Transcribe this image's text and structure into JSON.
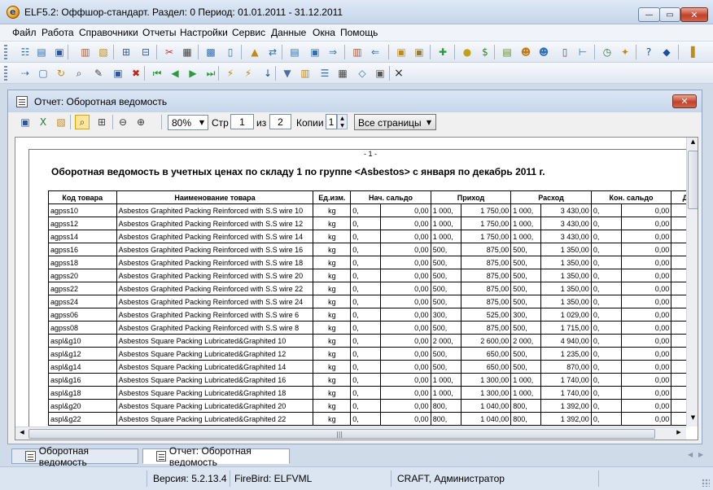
{
  "window": {
    "title": "ELF5.2: Оффшор-стандарт. Раздел: 0 Период: 01.01.2011 - 31.12.2011",
    "icon_letter": "e",
    "min_glyph": "—",
    "max_glyph": "▭",
    "close_glyph": "✕"
  },
  "menu": [
    "Файл",
    "Работа",
    "Справочники",
    "Отчеты",
    "Настройки",
    "Сервис",
    "Данные",
    "Окна",
    "Помощь"
  ],
  "toolbar2": {
    "close_glyph": "×"
  },
  "child_window": {
    "title": "Отчет: Оборотная ведомость",
    "close_glyph": "✕"
  },
  "report_toolbar": {
    "zoom": "80%",
    "page_label": "Стр",
    "page_current": "1",
    "of_label": "из",
    "page_total": "2",
    "copies_label": "Копии",
    "copies": "1",
    "pages_option": "Все страницы"
  },
  "report": {
    "page_marker": "- 1 -",
    "title": "Оборотная ведомость в учетных ценах по складу 1  по группе <Asbestos>  с января по декабрь 2011 г.",
    "columns": [
      "Код товара",
      "Наименование товара",
      "Ед.изм.",
      "Нач. сальдо",
      "Приход",
      "Расход",
      "Кон. сальдо",
      "До"
    ],
    "rows": [
      [
        "agpss10",
        "Asbestos Graphited Packing Reinforced with S.S wire 10",
        "kg",
        "0,",
        "0,00",
        "1 000,",
        "1 750,00",
        "1 000,",
        "3 430,00",
        "0,",
        "0,00"
      ],
      [
        "agpss12",
        "Asbestos Graphited Packing Reinforced with S.S wire 12",
        "kg",
        "0,",
        "0,00",
        "1 000,",
        "1 750,00",
        "1 000,",
        "3 430,00",
        "0,",
        "0,00"
      ],
      [
        "agpss14",
        "Asbestos Graphited Packing Reinforced with S.S wire 14",
        "kg",
        "0,",
        "0,00",
        "1 000,",
        "1 750,00",
        "1 000,",
        "3 430,00",
        "0,",
        "0,00"
      ],
      [
        "agpss16",
        "Asbestos Graphited Packing Reinforced with S.S wire 16",
        "kg",
        "0,",
        "0,00",
        "500,",
        "875,00",
        "500,",
        "1 350,00",
        "0,",
        "0,00"
      ],
      [
        "agpss18",
        "Asbestos Graphited Packing Reinforced with S.S wire 18",
        "kg",
        "0,",
        "0,00",
        "500,",
        "875,00",
        "500,",
        "1 350,00",
        "0,",
        "0,00"
      ],
      [
        "agpss20",
        "Asbestos Graphited Packing Reinforced with S.S wire 20",
        "kg",
        "0,",
        "0,00",
        "500,",
        "875,00",
        "500,",
        "1 350,00",
        "0,",
        "0,00"
      ],
      [
        "agpss22",
        "Asbestos Graphited Packing Reinforced with S.S wire 22",
        "kg",
        "0,",
        "0,00",
        "500,",
        "875,00",
        "500,",
        "1 350,00",
        "0,",
        "0,00"
      ],
      [
        "agpss24",
        "Asbestos Graphited Packing Reinforced with S.S wire 24",
        "kg",
        "0,",
        "0,00",
        "500,",
        "875,00",
        "500,",
        "1 350,00",
        "0,",
        "0,00"
      ],
      [
        "agpss06",
        "Asbestos Graphited Packing Reinforced with S.S wire 6",
        "kg",
        "0,",
        "0,00",
        "300,",
        "525,00",
        "300,",
        "1 029,00",
        "0,",
        "0,00"
      ],
      [
        "agpss08",
        "Asbestos Graphited Packing Reinforced with S.S wire 8",
        "kg",
        "0,",
        "0,00",
        "500,",
        "875,00",
        "500,",
        "1 715,00",
        "0,",
        "0,00"
      ],
      [
        "aspl&g10",
        "Asbestos Square Packing Lubricated&Graphited 10",
        "kg",
        "0,",
        "0,00",
        "2 000,",
        "2 600,00",
        "2 000,",
        "4 940,00",
        "0,",
        "0,00"
      ],
      [
        "aspl&g12",
        "Asbestos Square Packing Lubricated&Graphited 12",
        "kg",
        "0,",
        "0,00",
        "500,",
        "650,00",
        "500,",
        "1 235,00",
        "0,",
        "0,00"
      ],
      [
        "aspl&g14",
        "Asbestos Square Packing Lubricated&Graphited 14",
        "kg",
        "0,",
        "0,00",
        "500,",
        "650,00",
        "500,",
        "870,00",
        "0,",
        "0,00"
      ],
      [
        "aspl&g16",
        "Asbestos Square Packing Lubricated&Graphited 16",
        "kg",
        "0,",
        "0,00",
        "1 000,",
        "1 300,00",
        "1 000,",
        "1 740,00",
        "0,",
        "0,00"
      ],
      [
        "aspl&g18",
        "Asbestos Square Packing Lubricated&Graphited 18",
        "kg",
        "0,",
        "0,00",
        "1 000,",
        "1 300,00",
        "1 000,",
        "1 740,00",
        "0,",
        "0,00"
      ],
      [
        "aspl&g20",
        "Asbestos Square Packing Lubricated&Graphited 20",
        "kg",
        "0,",
        "0,00",
        "800,",
        "1 040,00",
        "800,",
        "1 392,00",
        "0,",
        "0,00"
      ],
      [
        "aspl&g22",
        "Asbestos Square Packing Lubricated&Graphited 22",
        "kg",
        "0,",
        "0,00",
        "800,",
        "1 040,00",
        "800,",
        "1 392,00",
        "0,",
        "0,00"
      ]
    ]
  },
  "tabs": [
    "Оборотная ведомость",
    "Отчет: Оборотная ведомость"
  ],
  "status": {
    "version": "Версия: 5.2.13.4",
    "db": "FireBird: ELFVML",
    "user": "CRAFT, Администратор"
  },
  "icons": {
    "toolbar1": [
      {
        "name": "tree-view-icon",
        "glyph": "☷",
        "color": "#2f6fb5"
      },
      {
        "name": "grid-view-icon",
        "glyph": "▤",
        "color": "#2f6fb5"
      },
      {
        "name": "box-icon",
        "glyph": "▣",
        "color": "#2c56a0"
      },
      {
        "name": "books-icon",
        "glyph": "▥",
        "color": "#b5542c"
      },
      {
        "name": "folder-add-icon",
        "glyph": "▧",
        "color": "#c28a18"
      },
      {
        "name": "hierarchy-icon",
        "glyph": "⊞",
        "color": "#3a5f9a"
      },
      {
        "name": "structure-icon",
        "glyph": "⊟",
        "color": "#3a5f9a"
      },
      {
        "name": "tools-icon",
        "glyph": "✂",
        "color": "#c23a2a"
      },
      {
        "name": "printer-icon",
        "glyph": "▦",
        "color": "#444444"
      },
      {
        "name": "calculator-icon",
        "glyph": "▩",
        "color": "#2f6fb5"
      },
      {
        "name": "document-icon",
        "glyph": "▯",
        "color": "#2f6fb5"
      },
      {
        "name": "lock-icon",
        "glyph": "▲",
        "color": "#c28a18"
      },
      {
        "name": "transfer-icon",
        "glyph": "⇄",
        "color": "#2f6fb5"
      },
      {
        "name": "calendar-icon",
        "glyph": "▤",
        "color": "#2f6fb5"
      },
      {
        "name": "image-icon",
        "glyph": "▣",
        "color": "#2f6fb5"
      },
      {
        "name": "export-icon",
        "glyph": "⇒",
        "color": "#2f6fb5"
      },
      {
        "name": "journal-icon",
        "glyph": "▥",
        "color": "#b5542c"
      },
      {
        "name": "import-icon",
        "glyph": "⇐",
        "color": "#2f6fb5"
      },
      {
        "name": "package-icon",
        "glyph": "▣",
        "color": "#c28a18"
      },
      {
        "name": "package2-icon",
        "glyph": "▣",
        "color": "#9a7a3a"
      },
      {
        "name": "add-green-icon",
        "glyph": "✚",
        "color": "#2a9a3a"
      },
      {
        "name": "coin-icon",
        "glyph": "●",
        "color": "#c2a018"
      },
      {
        "name": "dollar-icon",
        "glyph": "$",
        "color": "#2a8a2a"
      },
      {
        "name": "docs-icon",
        "glyph": "▤",
        "color": "#6a8a2a"
      },
      {
        "name": "user-icon",
        "glyph": "☻",
        "color": "#c27a18"
      },
      {
        "name": "users-icon",
        "glyph": "☻",
        "color": "#2f6fb5"
      },
      {
        "name": "page-icon",
        "glyph": "▯",
        "color": "#555555"
      },
      {
        "name": "tree-icon",
        "glyph": "⊢",
        "color": "#2f6fb5"
      },
      {
        "name": "clock-icon",
        "glyph": "◷",
        "color": "#2a7a3a"
      },
      {
        "name": "settings-icon",
        "glyph": "✦",
        "color": "#c28a18"
      },
      {
        "name": "help-icon",
        "glyph": "?",
        "color": "#1a4f9a"
      },
      {
        "name": "diamond-icon",
        "glyph": "◆",
        "color": "#1a4f9a"
      },
      {
        "name": "exit-icon",
        "glyph": "▐",
        "color": "#c28a18"
      }
    ],
    "toolbar2": [
      {
        "name": "insert-icon",
        "glyph": "⇢",
        "color": "#2f6fb5"
      },
      {
        "name": "copy-icon",
        "glyph": "▢",
        "color": "#2f6fb5"
      },
      {
        "name": "refresh-icon",
        "glyph": "↻",
        "color": "#c28a18"
      },
      {
        "name": "find-icon",
        "glyph": "⌕",
        "color": "#444444"
      },
      {
        "name": "edit-icon",
        "glyph": "✎",
        "color": "#444444"
      },
      {
        "name": "save-icon",
        "glyph": "▣",
        "color": "#2c56a0"
      },
      {
        "name": "delete-icon",
        "glyph": "✖",
        "color": "#c2241a"
      },
      {
        "name": "first-icon",
        "glyph": "⏮",
        "color": "#2a9a3a"
      },
      {
        "name": "prev-icon",
        "glyph": "◀",
        "color": "#2a9a3a"
      },
      {
        "name": "next-icon",
        "glyph": "▶",
        "color": "#2a9a3a"
      },
      {
        "name": "last-icon",
        "glyph": "⏭",
        "color": "#2a9a3a"
      },
      {
        "name": "wand-icon",
        "glyph": "⚡",
        "color": "#c28a18"
      },
      {
        "name": "wand2-icon",
        "glyph": "⚡",
        "color": "#c28a18"
      },
      {
        "name": "sort-icon",
        "glyph": "↓",
        "color": "#1a4f9a"
      },
      {
        "name": "filter-icon",
        "glyph": "▼",
        "color": "#4a6fa0"
      },
      {
        "name": "columns-icon",
        "glyph": "▥",
        "color": "#c28a18"
      },
      {
        "name": "list-icon",
        "glyph": "☰",
        "color": "#2f6fb5"
      },
      {
        "name": "print-icon",
        "glyph": "▦",
        "color": "#444444"
      },
      {
        "name": "code-icon",
        "glyph": "◇",
        "color": "#2f6fb5"
      },
      {
        "name": "save-as-icon",
        "glyph": "▣",
        "color": "#555555"
      }
    ],
    "report": [
      {
        "name": "save-report-icon",
        "glyph": "▣",
        "color": "#2c56a0"
      },
      {
        "name": "excel-icon",
        "glyph": "X",
        "color": "#1e7a34"
      },
      {
        "name": "settings-report-icon",
        "glyph": "▧",
        "color": "#c28a18"
      },
      {
        "name": "preview-icon",
        "glyph": "⌕",
        "color": "#444444"
      },
      {
        "name": "page-setup-icon",
        "glyph": "⊞",
        "color": "#444444"
      },
      {
        "name": "zoom-out-icon",
        "glyph": "⊖",
        "color": "#333333"
      },
      {
        "name": "zoom-in-icon",
        "glyph": "⊕",
        "color": "#333333"
      }
    ]
  }
}
